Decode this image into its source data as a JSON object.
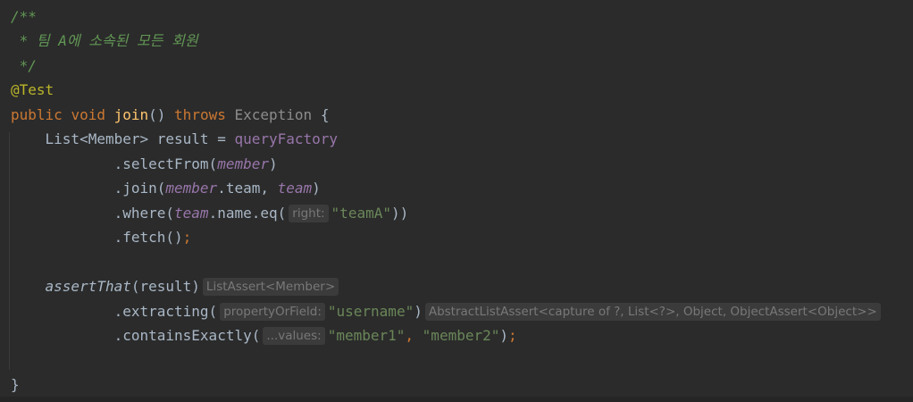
{
  "code": {
    "comment_open": "/**",
    "comment_body": " * 팀 A에 소속된 모든 회원",
    "comment_close": " */",
    "annotation": "@Test",
    "kw_public": "public",
    "kw_void": "void",
    "method_name": "join",
    "parens": "()",
    "kw_throws": "throws",
    "exception": "Exception",
    "open_brace": "{",
    "list_decl": "List<Member> result = ",
    "query_factory": "queryFactory",
    "select_from": ".selectFrom(",
    "member": "member",
    "close_paren": ")",
    "join_open": ".join(",
    "team_suffix": ".team, ",
    "team": "team",
    "where_open": ".where(",
    "name_eq": ".name.eq(",
    "hint_right": "right:",
    "team_a": "\"teamA\"",
    "double_close": "))",
    "fetch": ".fetch()",
    "semicolon": ";",
    "assert_that": "assertThat",
    "result_arg": "(result)",
    "hint_list_assert": "ListAssert<Member>",
    "extracting": ".extracting(",
    "hint_property": "propertyOrField:",
    "username": "\"username\"",
    "hint_abstract": "AbstractListAssert<capture of ?, List<?>, Object, ObjectAssert<Object>>",
    "contains_exactly": ".containsExactly(",
    "hint_values": "...values:",
    "member1": "\"member1\"",
    "comma_space": ", ",
    "member2": "\"member2\"",
    "close_brace": "}"
  }
}
